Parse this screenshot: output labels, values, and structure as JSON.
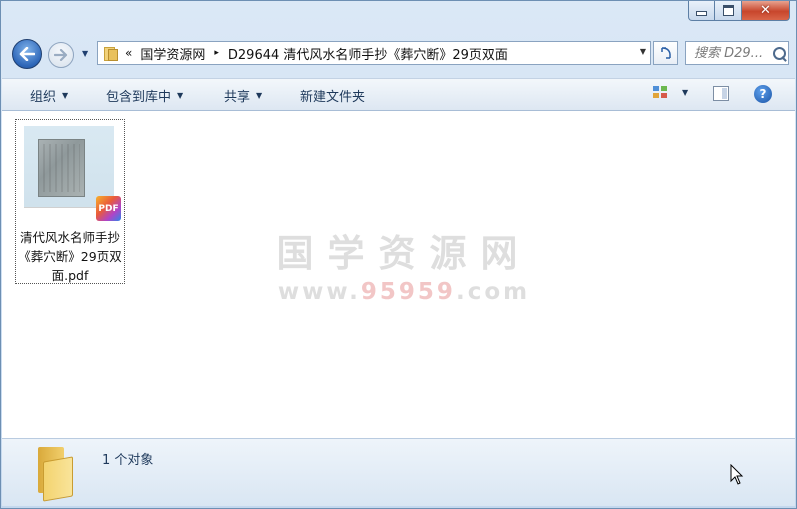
{
  "window": {
    "caption": {
      "minimize_label": "",
      "maximize_label": "",
      "close_glyph": "✕"
    }
  },
  "nav": {
    "breadcrumb_chevron": "«",
    "breadcrumb": [
      "国学资源网",
      "D29644 清代风水名师手抄《葬穴断》29页双面"
    ],
    "breadcrumb_sep": "▸",
    "search_placeholder": "搜索 D29...",
    "refresh_glyph": "↲↱"
  },
  "toolbar": {
    "organize": "组织",
    "include_library": "包含到库中",
    "share": "共享",
    "new_folder": "新建文件夹",
    "help": "?"
  },
  "files": [
    {
      "name": "清代风水名师手抄《葬穴断》29页双面.pdf",
      "badge": "PDF"
    }
  ],
  "watermark": {
    "line1": "国学资源网",
    "line2_prefix": "www.",
    "line2_num": "95959",
    "line2_suffix": ".com"
  },
  "status": {
    "count_text": "1 个对象"
  },
  "colors": {
    "accent": "#1e395b",
    "close": "#c8462c",
    "folder": "#f1cf6d"
  }
}
